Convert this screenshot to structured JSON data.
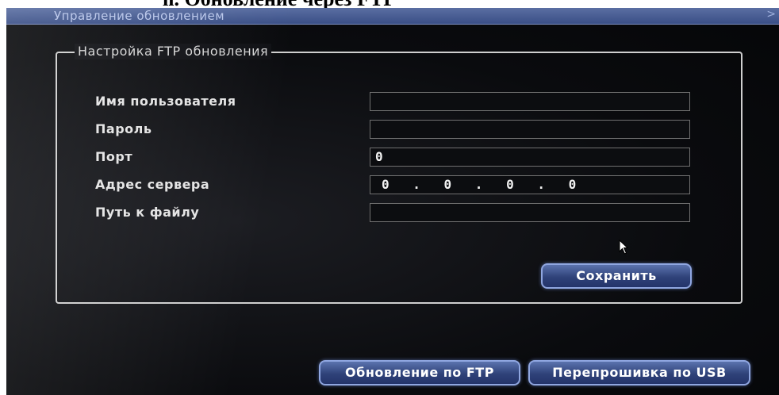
{
  "document": {
    "heading": "ii. Обновление через FTP"
  },
  "window": {
    "title": "Управление обновлением",
    "close_glyph": ">"
  },
  "group": {
    "legend": "Настройка FTP обновления"
  },
  "form": {
    "fields": [
      {
        "label": "Имя пользователя",
        "value": ""
      },
      {
        "label": "Пароль",
        "value": ""
      },
      {
        "label": "Порт",
        "value": "0"
      },
      {
        "label": "Адрес сервера",
        "value": "0 . 0 . 0 . 0"
      },
      {
        "label": "Путь к файлу",
        "value": ""
      }
    ]
  },
  "buttons": {
    "save": "Сохранить",
    "ftp_update": "Обновление по FTP",
    "usb_flash": "Перепрошивка по USB"
  },
  "colors": {
    "accent": "#8fa6e0",
    "titlebar": "#3a4f86"
  },
  "icons": {
    "cursor": "mouse-pointer-icon"
  }
}
